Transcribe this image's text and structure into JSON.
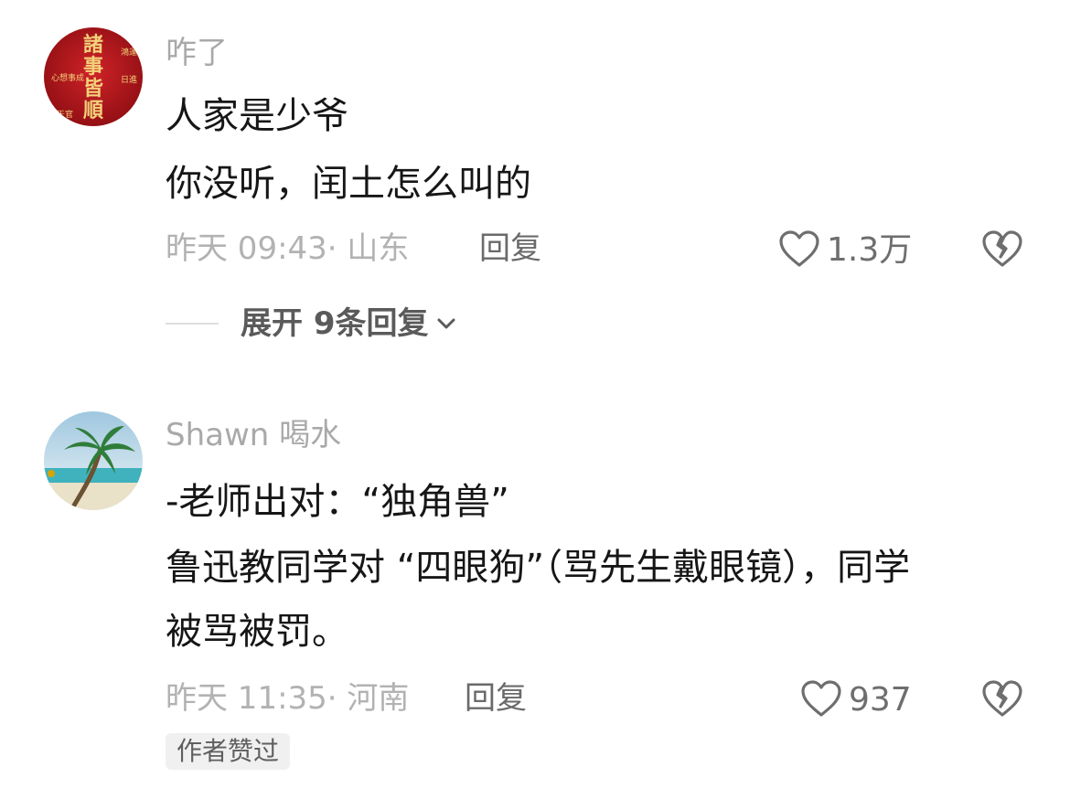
{
  "comments": [
    {
      "username": "咋了",
      "avatar_text": [
        "諸事皆順",
        "鴻運當頭",
        "日進斗金",
        "心想事成",
        "天官"
      ],
      "lines": [
        "人家是少爷",
        "你没听，闰土怎么叫的"
      ],
      "time": "昨天 09:43",
      "location": "山东",
      "reply_label": "回复",
      "likes": "1.3万",
      "expand_label": "展开 9条回复"
    },
    {
      "username": "Shawn 喝水",
      "lines": [
        "-老师出对：“独角兽”",
        "鲁迅教同学对 “四眼狗”（骂先生戴眼镜），同学",
        "被骂被罚。"
      ],
      "time": "昨天 11:35",
      "location": "河南",
      "reply_label": "回复",
      "likes": "937",
      "badge": "作者赞过"
    }
  ],
  "colors": {
    "username": "#a9a9a9",
    "body_text": "#161616",
    "meta": "#b2b2b2",
    "avatar1_bg": "#b3141a",
    "badge_bg": "#f0f0f0"
  },
  "icons": [
    "heart-outline-icon",
    "broken-heart-icon",
    "chevron-down-icon"
  ]
}
